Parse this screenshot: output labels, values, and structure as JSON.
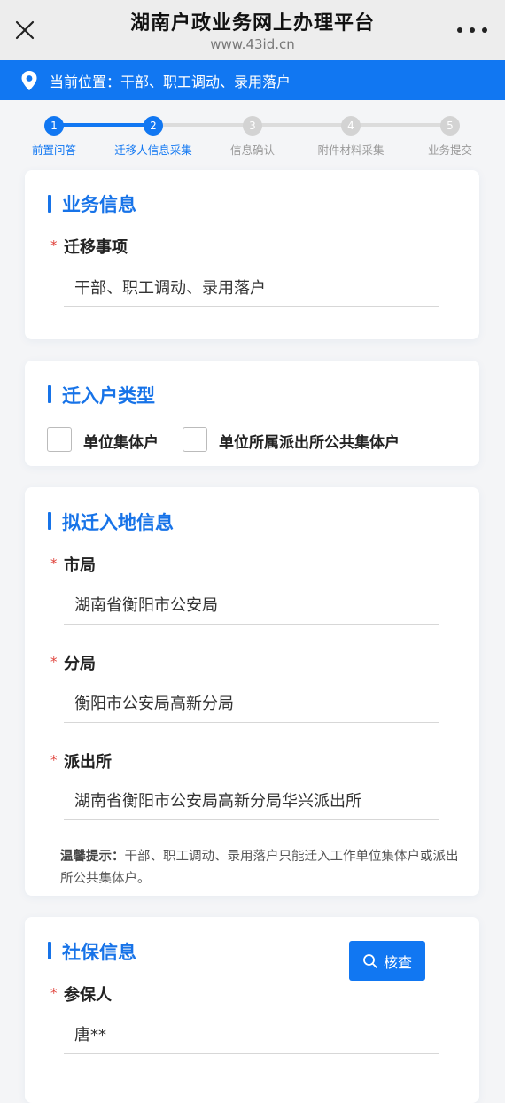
{
  "header": {
    "title": "湖南户政业务网上办理平台",
    "url": "www.43id.cn"
  },
  "location": {
    "label": "当前位置：",
    "path": "干部、职工调动、录用落户"
  },
  "steps": [
    {
      "num": "1",
      "label": "前置问答",
      "state": "done"
    },
    {
      "num": "2",
      "label": "迁移人信息采集",
      "state": "active"
    },
    {
      "num": "3",
      "label": "信息确认",
      "state": "todo"
    },
    {
      "num": "4",
      "label": "附件材料采集",
      "state": "todo"
    },
    {
      "num": "5",
      "label": "业务提交",
      "state": "todo"
    }
  ],
  "business": {
    "title": "业务信息",
    "item_label": "迁移事项",
    "item_value": "干部、职工调动、录用落户"
  },
  "household_type": {
    "title": "迁入户类型",
    "options": [
      "单位集体户",
      "单位所属派出所公共集体户"
    ]
  },
  "destination": {
    "title": "拟迁入地信息",
    "city_label": "市局",
    "city_value": "湖南省衡阳市公安局",
    "branch_label": "分局",
    "branch_value": "衡阳市公安局高新分局",
    "station_label": "派出所",
    "station_value": "湖南省衡阳市公安局高新分局华兴派出所",
    "tip_label": "温馨提示：",
    "tip_text": "干部、职工调动、录用落户只能迁入工作单位集体户或派出所公共集体户。"
  },
  "social": {
    "title": "社保信息",
    "check_button": "核查",
    "insured_label": "参保人",
    "insured_value": "唐**"
  },
  "colors": {
    "accent": "#1177f2",
    "required": "#e0433c"
  }
}
